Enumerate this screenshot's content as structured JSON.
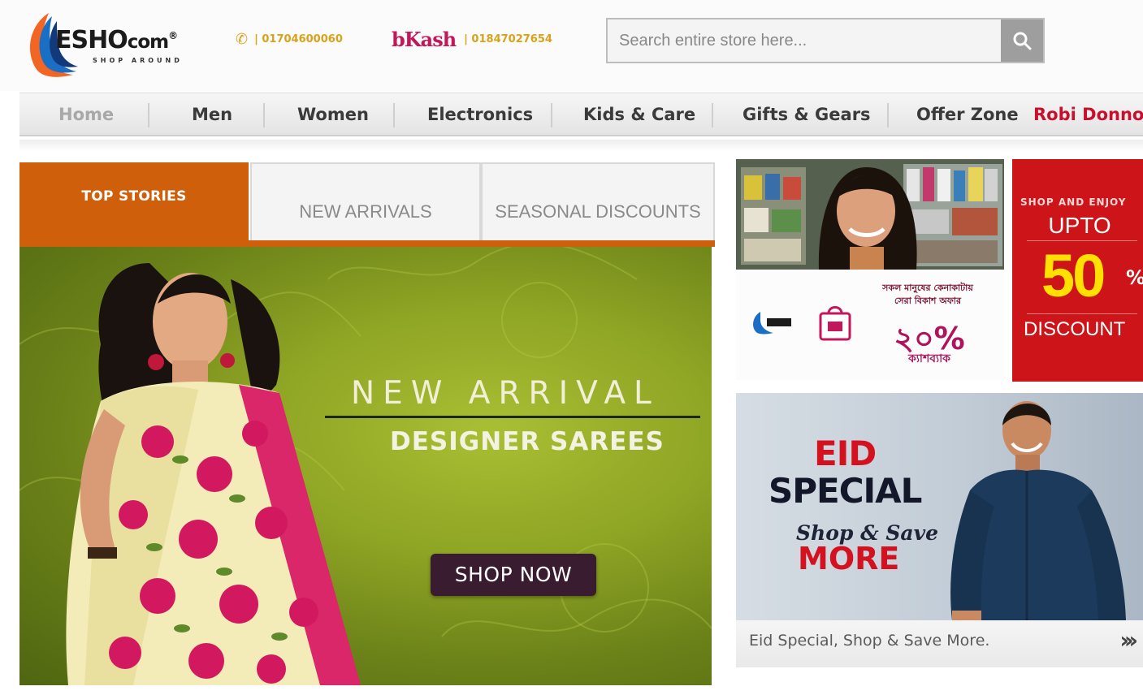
{
  "header": {
    "logo": {
      "brand_main": "ESHO",
      "brand_suffix": "com",
      "tagline": "SHOP AROUND"
    },
    "phone": "| 01704600060",
    "bkash": {
      "name": "bKash",
      "number": "| 01847027654"
    },
    "search": {
      "placeholder": "Search entire store here..."
    }
  },
  "nav": {
    "items": [
      {
        "label": "Home"
      },
      {
        "label": "Men"
      },
      {
        "label": "Women"
      },
      {
        "label": "Electronics"
      },
      {
        "label": "Kids & Care"
      },
      {
        "label": "Gifts & Gears"
      },
      {
        "label": "Offer Zone"
      },
      {
        "label": "Robi Donno"
      }
    ]
  },
  "tabs": [
    {
      "label": "TOP STORIES",
      "active": true
    },
    {
      "label": "NEW ARRIVALS",
      "active": false
    },
    {
      "label": "SEASONAL DISCOUNTS",
      "active": false
    }
  ],
  "hero": {
    "title": "NEW ARRIVAL",
    "subtitle": "DESIGNER SAREES",
    "cta": "SHOP NOW"
  },
  "promos": {
    "bn_offer": {
      "line1": "সকল মানুষের কেনাকাটায়",
      "line2": "সেরা বিকাশ অফার",
      "percent": "২০%",
      "label": "ক্যাশব্যাক"
    },
    "discount": {
      "line1": "SHOP AND ENJOY",
      "line2": "UPTO",
      "amount": "50",
      "percent": "%",
      "line3": "DISCOUNT"
    },
    "eid": {
      "line1": "EID",
      "line2": "SPECIAL",
      "line3": "Shop & Save",
      "line4": "MORE"
    },
    "caption": {
      "text": "Eid Special, Shop & Save More.",
      "arrow": "›››"
    }
  },
  "colors": {
    "accent_orange": "#cf5f0b",
    "discount_red": "#cd1419",
    "robi_red": "#c8102e",
    "bkash_pink": "#c2185b",
    "hero_green": "#8ea424"
  }
}
